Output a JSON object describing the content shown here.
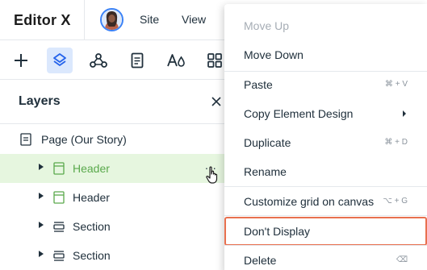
{
  "app": {
    "logo": "Editor X"
  },
  "topmenu": {
    "site": "Site",
    "view": "View"
  },
  "layers": {
    "title": "Layers",
    "page": "Page (Our Story)",
    "rows": [
      {
        "label": "Header",
        "type": "header",
        "selected": true
      },
      {
        "label": "Header",
        "type": "header",
        "selected": false
      },
      {
        "label": "Section",
        "type": "section",
        "selected": false
      },
      {
        "label": "Section",
        "type": "section",
        "selected": false
      }
    ],
    "more_label": "..."
  },
  "context_menu": {
    "items": [
      {
        "label": "Move Up",
        "disabled": true
      },
      {
        "label": "Move Down"
      },
      {
        "label": "Paste",
        "shortcut": "⌘ + V"
      },
      {
        "label": "Copy Element Design",
        "submenu": true
      },
      {
        "label": "Duplicate",
        "shortcut": "⌘ + D"
      },
      {
        "label": "Rename"
      },
      {
        "label": "Customize grid on canvas",
        "shortcut": "⌥ + G"
      },
      {
        "label": "Don't Display",
        "highlighted": true
      },
      {
        "label": "Delete",
        "shortcut": "⌫"
      }
    ]
  },
  "colors": {
    "accent_blue": "#3b82f6",
    "selection_green": "#5aa94c",
    "highlight_border": "#e8704f"
  }
}
